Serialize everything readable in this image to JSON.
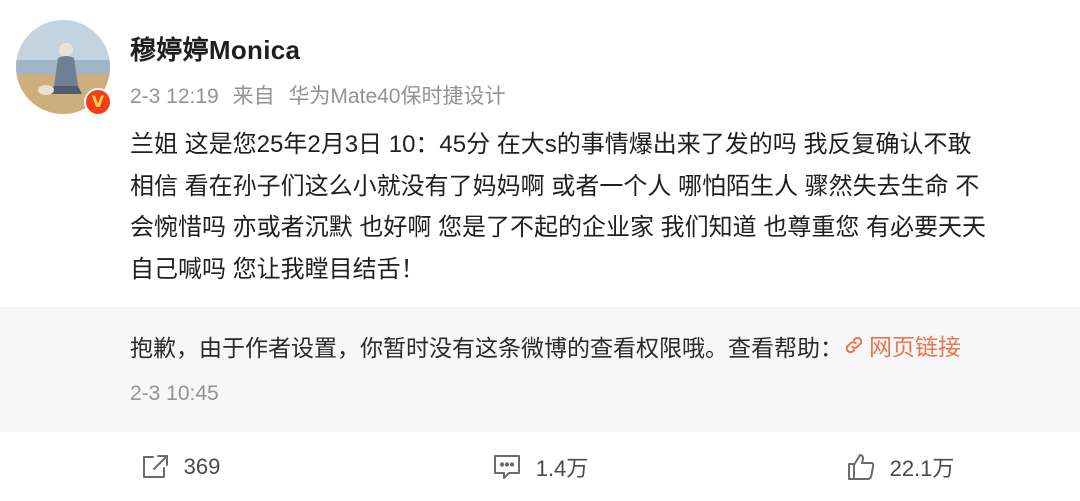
{
  "user": {
    "name": "穆婷婷Monica",
    "time": "2-3 12:19",
    "source_prefix": "来自",
    "source_device": "华为Mate40保时捷设计"
  },
  "content": {
    "lines": [
      "兰姐 这是您25年2月3日 10：45分 在大s的事情爆出来了发的吗 我反复确认不敢",
      "相信 看在孙子们这么小就没有了妈妈啊 或者一个人 哪怕陌生人 骤然失去生命 不",
      "会惋惜吗 亦或者沉默 也好啊 您是了不起的企业家 我们知道 也尊重您 有必要天天",
      "自己喊吗 您让我瞠目结舌！"
    ]
  },
  "repost": {
    "notice": "抱歉，由于作者设置，你暂时没有这条微博的查看权限哦。查看帮助：",
    "link_label": "网页链接",
    "time": "2-3 10:45"
  },
  "actions": {
    "repost_count": "369",
    "comment_count": "1.4万",
    "like_count": "22.1万"
  },
  "colors": {
    "link": "#eb7350",
    "verified": "#f23c1a"
  },
  "icons": [
    "verified-badge-icon",
    "link-icon",
    "repost-icon",
    "comment-icon",
    "like-icon"
  ]
}
